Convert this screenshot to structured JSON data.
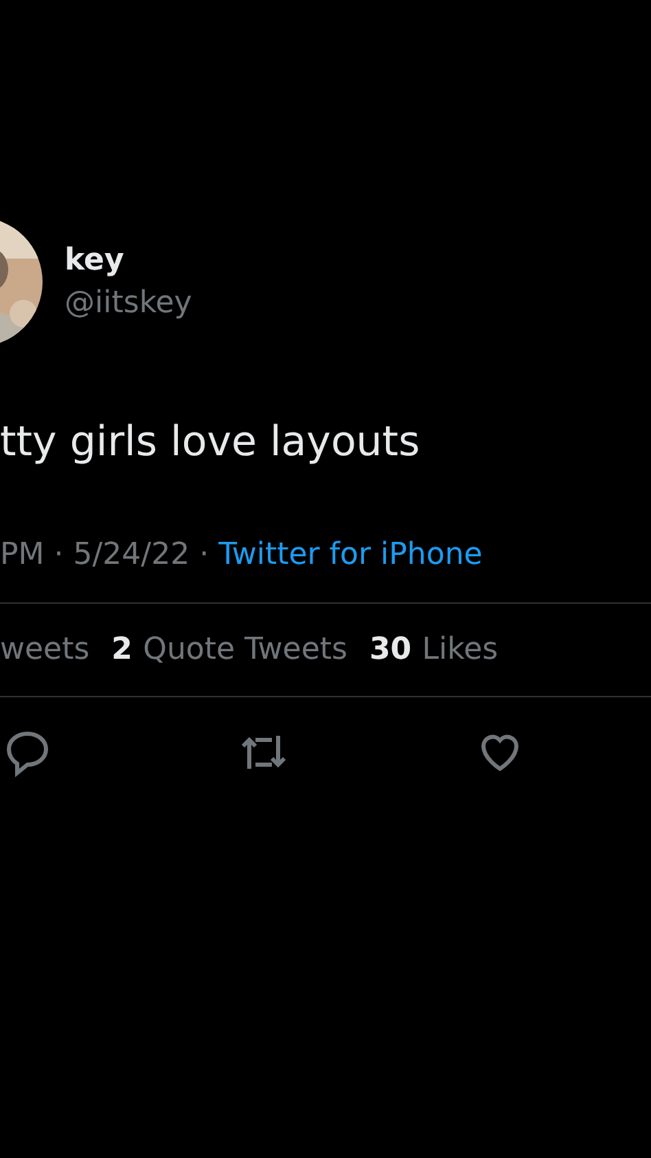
{
  "author": {
    "name": "key",
    "handle": "@iitskey"
  },
  "text": "tty girls love layouts",
  "meta": {
    "time": "PM",
    "separator": "·",
    "date": "5/24/22",
    "source": "Twitter for iPhone"
  },
  "stats": [
    {
      "label": "weets"
    },
    {
      "count": "2",
      "label": "Quote Tweets"
    },
    {
      "count": "30",
      "label": "Likes"
    }
  ],
  "actions": [
    {
      "kind": "reply"
    },
    {
      "kind": "retweet"
    },
    {
      "kind": "like"
    }
  ]
}
